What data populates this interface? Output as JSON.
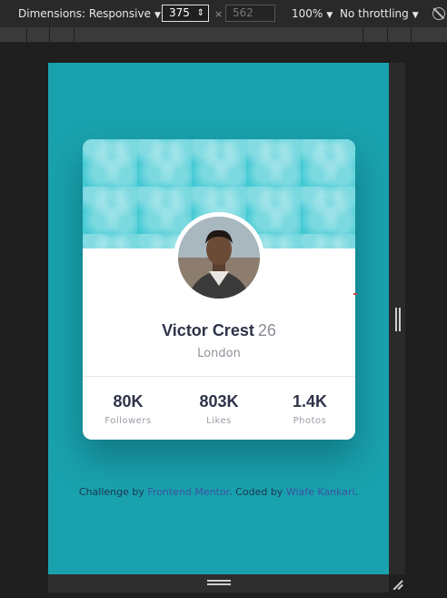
{
  "toolbar": {
    "dimensions_label": "Dimensions: Responsive",
    "width_value": "375",
    "times_glyph": "×",
    "height_placeholder": "562",
    "zoom_label": "100%",
    "throttle_label": "No throttling",
    "caret": "▼"
  },
  "card": {
    "name": "Victor Crest",
    "age": "26",
    "location": "London",
    "stats": [
      {
        "value": "80K",
        "label": "Followers"
      },
      {
        "value": "803K",
        "label": "Likes"
      },
      {
        "value": "1.4K",
        "label": "Photos"
      }
    ]
  },
  "attribution": {
    "prefix": "Challenge by ",
    "link1": "Frontend Mentor",
    "middle": ". Coded by ",
    "link2": "Wiafe Kankari",
    "suffix": "."
  },
  "colors": {
    "page_bg": "#19a2ae",
    "card_header": "#42c9d3",
    "text_dark": "#2e3349",
    "link": "#3e52a3"
  }
}
